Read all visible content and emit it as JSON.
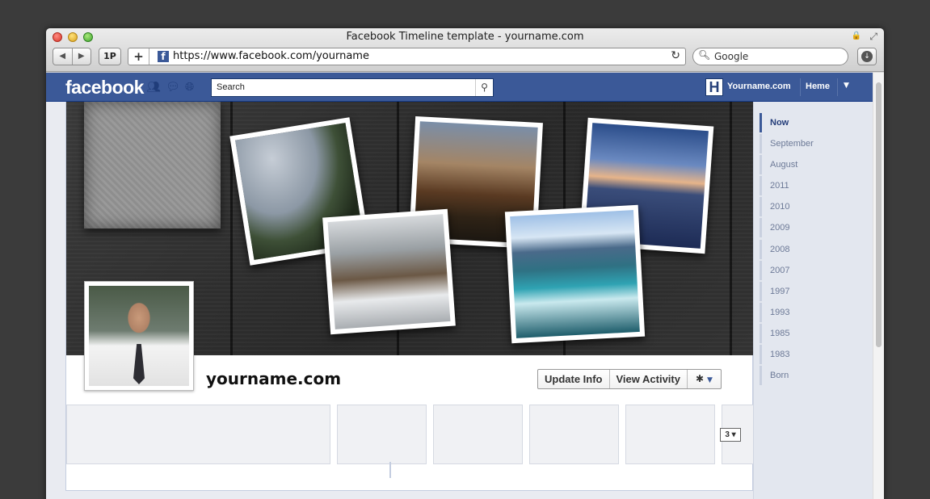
{
  "browser": {
    "window_title": "Facebook Timeline template - yourname.com",
    "back_label": "◀",
    "forward_label": "▶",
    "onepassword_label": "1P",
    "new_tab_label": "+",
    "favicon_letter": "f",
    "url": "https://www.facebook.com/yourname",
    "search_placeholder": "Google",
    "reload_icon": "reload-icon",
    "download_icon": "download-icon"
  },
  "fb_header": {
    "logo": "facebook",
    "search_placeholder": "Search",
    "user_initial": "H",
    "user_name": "Yourname.com",
    "home_label": "Heme",
    "icons": [
      "friends-icon",
      "messages-icon",
      "notifications-globe-icon"
    ]
  },
  "profile": {
    "name": "yourname.com",
    "update_info_label": "Update Info",
    "view_activity_label": "View Activity",
    "more_count": "3"
  },
  "scrubber": {
    "items": [
      {
        "label": "Now",
        "active": true
      },
      {
        "label": "September",
        "active": false
      },
      {
        "label": "August",
        "active": false
      },
      {
        "label": "2011",
        "active": false
      },
      {
        "label": "2010",
        "active": false
      },
      {
        "label": "2009",
        "active": false
      },
      {
        "label": "2008",
        "active": false
      },
      {
        "label": "2007",
        "active": false
      },
      {
        "label": "1997",
        "active": false
      },
      {
        "label": "1993",
        "active": false
      },
      {
        "label": "1985",
        "active": false
      },
      {
        "label": "1983",
        "active": false
      },
      {
        "label": "Born",
        "active": false
      }
    ]
  },
  "colors": {
    "fb_blue": "#3b5998",
    "scrubber_bg": "#e3e7ef"
  }
}
